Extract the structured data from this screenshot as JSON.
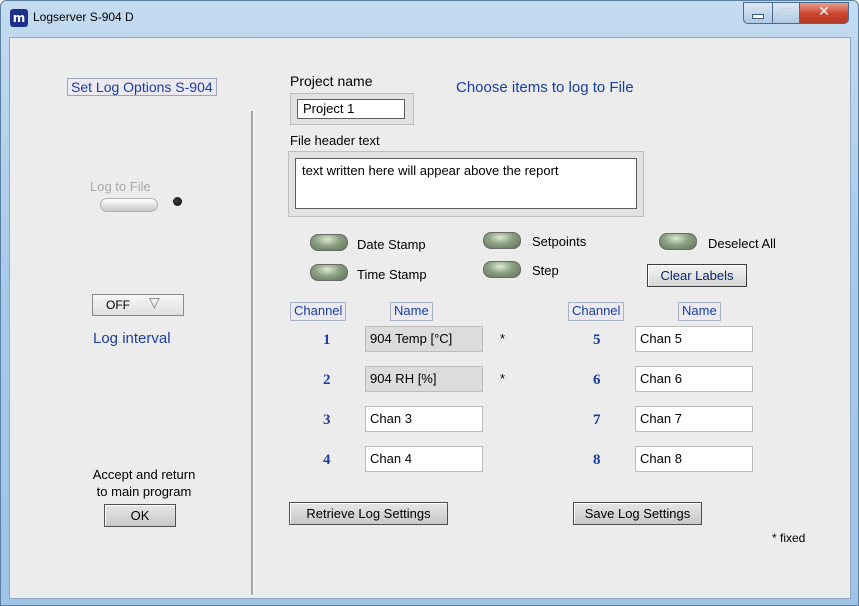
{
  "window": {
    "title": "Logserver S-904 D",
    "app_icon": "m"
  },
  "left_panel": {
    "set_log_options": "Set Log Options S-904",
    "log_to_file": "Log to File",
    "interval_value": "OFF",
    "interval_label": "Log interval",
    "accept_text": "Accept and return to main program",
    "ok_button": "OK"
  },
  "right_panel": {
    "project_name_label": "Project name",
    "project_name_value": "Project 1",
    "choose_items": "Choose items to log to File",
    "file_header_label": "File header text",
    "file_header_value": "text written here will appear above the report",
    "options": {
      "date_stamp": "Date Stamp",
      "time_stamp": "Time Stamp",
      "setpoints": "Setpoints",
      "step": "Step",
      "deselect_all": "Deselect All"
    },
    "clear_labels": "Clear Labels",
    "columns": {
      "channel": "Channel",
      "name": "Name"
    },
    "channels": [
      {
        "num": "1",
        "name": "904 Temp [°C]",
        "fixed": "*"
      },
      {
        "num": "2",
        "name": "904 RH [%]",
        "fixed": "*"
      },
      {
        "num": "3",
        "name": "Chan 3"
      },
      {
        "num": "4",
        "name": "Chan 4"
      },
      {
        "num": "5",
        "name": "Chan 5"
      },
      {
        "num": "6",
        "name": "Chan 6"
      },
      {
        "num": "7",
        "name": "Chan 7"
      },
      {
        "num": "8",
        "name": "Chan 8"
      }
    ],
    "retrieve_button": "Retrieve Log Settings",
    "save_button": "Save Log Settings",
    "fixed_note": "* fixed"
  }
}
